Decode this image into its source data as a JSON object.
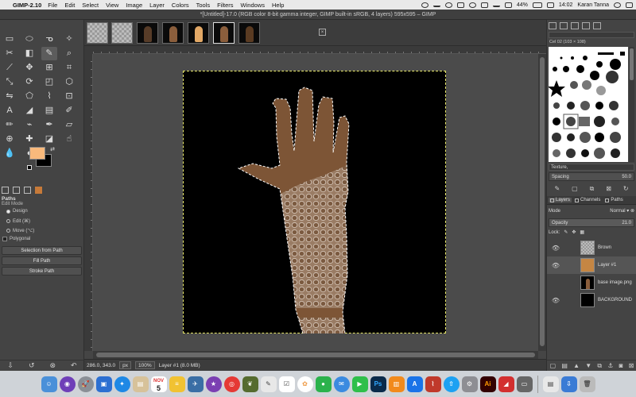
{
  "menubar": {
    "app_name": "GIMP-2.10",
    "items": [
      "File",
      "Edit",
      "Select",
      "View",
      "Image",
      "Layer",
      "Colors",
      "Tools",
      "Filters",
      "Windows",
      "Help"
    ],
    "battery": "44%",
    "clock": "14:02",
    "user": "Karan Tanna"
  },
  "window": {
    "title": "*[Untitled]-17.0 (RGB color 8-bit gamma integer, GIMP built-in sRGB, 4 layers) 595x595 – GIMP"
  },
  "toolbox": {
    "tools": [
      "rect-select",
      "ellipse-select",
      "lasso",
      "fuzzy-select",
      "scissors",
      "foreground-select",
      "paths",
      "color-picker",
      "zoom",
      "measure",
      "move",
      "align",
      "crop",
      "unified-transform",
      "rotate",
      "scale",
      "warp",
      "cage",
      "handle-transform",
      "perspective",
      "flip",
      "text",
      "bucket-fill",
      "gradient",
      "paintbrush",
      "pencil",
      "airbrush",
      "ink",
      "mypaint",
      "eraser",
      "clone",
      "heal",
      "perspective-clone",
      "blur",
      "smudge",
      "dodge-burn"
    ],
    "fg_color": "#f8b97c",
    "bg_color": "#000000",
    "options_title": "Paths",
    "edit_mode_label": "Edit Mode",
    "mode_design": "Design",
    "mode_edit": "Edit (⌘)",
    "mode_move": "Move (⌥)",
    "polygonal": "Polygonal",
    "btn_selection": "Selection from Path",
    "btn_fill": "Fill Path",
    "btn_stroke": "Stroke Path"
  },
  "status": {
    "coords": "286.0, 343.0",
    "unit": "px",
    "zoom": "100%",
    "layer_info": "Layer #1 (8.0 MB)"
  },
  "brushes": {
    "name": "Cel 02 (103 × 108)",
    "tag": "Texture,",
    "spacing_label": "Spacing",
    "spacing_value": "50.0"
  },
  "layers": {
    "tab_layers": "Layers",
    "tab_channels": "Channels",
    "tab_paths": "Paths",
    "mode_label": "Mode",
    "mode_value": "Normal",
    "opacity_label": "Opacity",
    "opacity_value": "21.0",
    "lock_label": "Lock:",
    "items": [
      {
        "name": "Brown",
        "visible": true
      },
      {
        "name": "Layer #1",
        "visible": true
      },
      {
        "name": "base image.png",
        "visible": false
      },
      {
        "name": "BACKGROUND",
        "visible": true
      }
    ]
  },
  "macdock": {
    "calendar_day": "5",
    "calendar_month": "NOV"
  },
  "colors": {
    "skin": "#7d5536",
    "skin_light": "#8b5e3c",
    "marching_ants": "#e8e86a"
  }
}
